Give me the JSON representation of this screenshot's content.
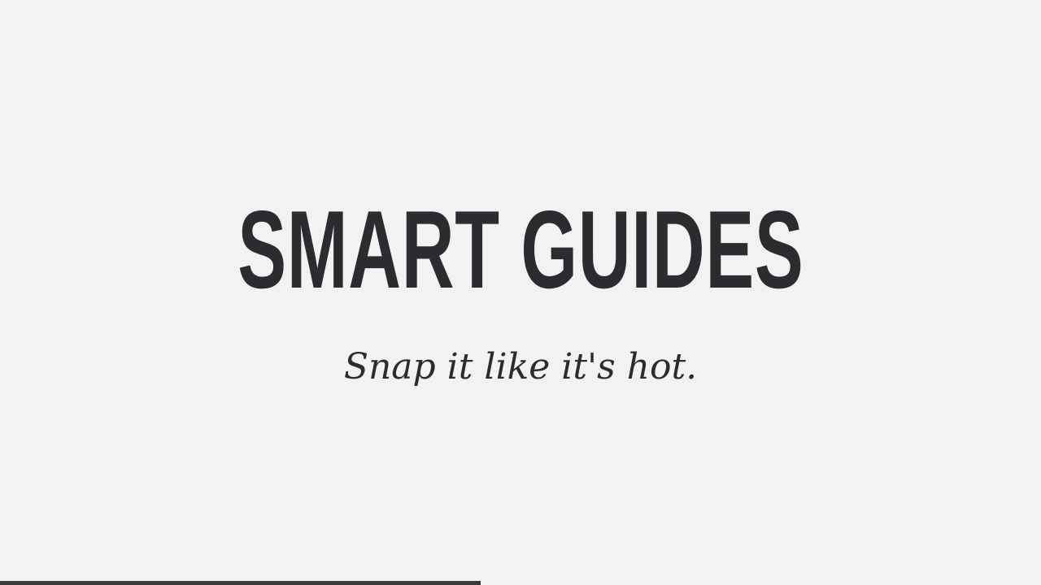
{
  "slide": {
    "title": "SMART GUIDES",
    "subtitle": "Snap it like it's hot."
  },
  "progress": {
    "fraction": 0.4617
  },
  "colors": {
    "background": "#f2f2f2",
    "text": "#2b2c30",
    "progress_bar": "#3a3a3c"
  }
}
